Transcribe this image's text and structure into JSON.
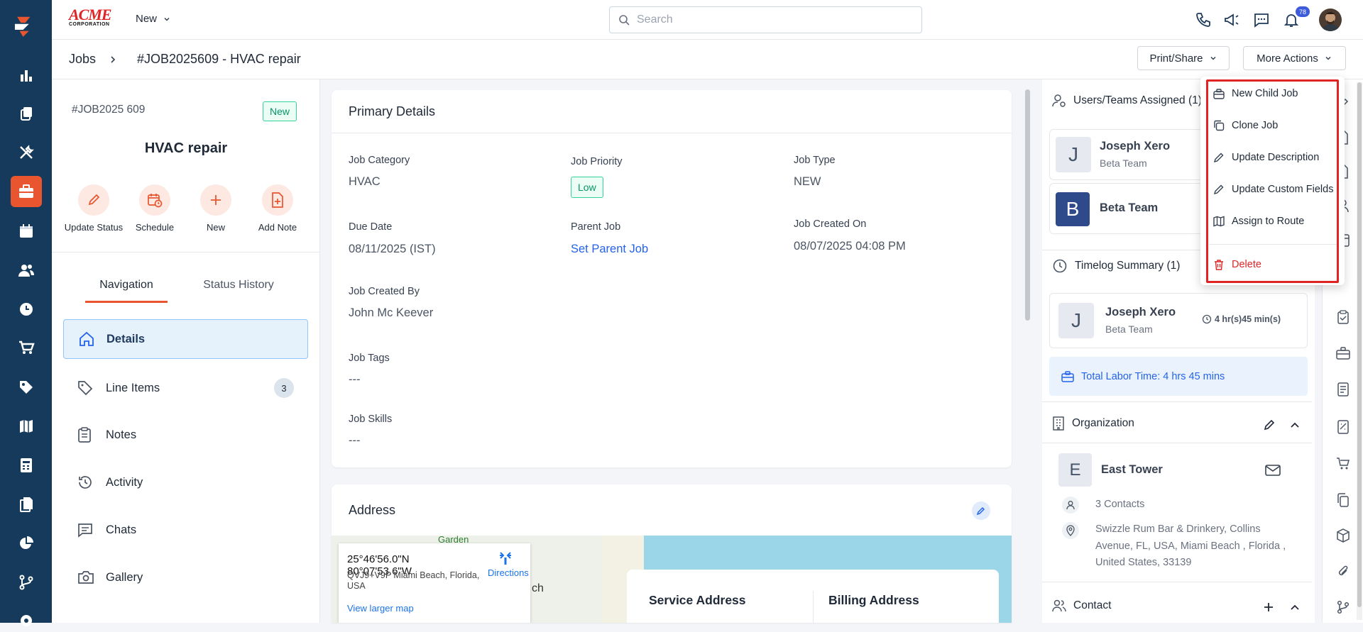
{
  "brand": {
    "logo_text": "ACME",
    "logo_sub": "CORPORATION"
  },
  "topbar": {
    "new_label": "New",
    "search_placeholder": "Search",
    "notification_count": "78"
  },
  "breadcrumb": {
    "root": "Jobs",
    "current": "#JOB2025609 - HVAC repair"
  },
  "header_actions": {
    "print_share": "Print/Share",
    "more_actions": "More Actions"
  },
  "job_summary": {
    "id": "#JOB2025 609",
    "status": "New",
    "title": "HVAC repair",
    "quick_actions": [
      "Update Status",
      "Schedule",
      "New",
      "Add Note"
    ]
  },
  "left_tabs": [
    "Navigation",
    "Status History"
  ],
  "nav_items": [
    {
      "label": "Details",
      "icon": "home-icon"
    },
    {
      "label": "Line Items",
      "icon": "tag-icon",
      "badge": "3"
    },
    {
      "label": "Notes",
      "icon": "clipboard-icon"
    },
    {
      "label": "Activity",
      "icon": "history-icon"
    },
    {
      "label": "Chats",
      "icon": "chat-icon"
    },
    {
      "label": "Gallery",
      "icon": "camera-icon"
    }
  ],
  "primary": {
    "title": "Primary Details",
    "job_category_label": "Job Category",
    "job_category": "HVAC",
    "job_priority_label": "Job Priority",
    "job_priority": "Low",
    "job_type_label": "Job Type",
    "job_type": "NEW",
    "due_date_label": "Due Date",
    "due_date": "08/11/2025 (IST)",
    "parent_job_label": "Parent Job",
    "parent_job": "Set Parent Job",
    "created_on_label": "Job Created On",
    "created_on": "08/07/2025 04:08 PM",
    "created_by_label": "Job Created By",
    "created_by": "John Mc Keever",
    "tags_label": "Job Tags",
    "tags": "---",
    "skills_label": "Job Skills",
    "skills": "---"
  },
  "address": {
    "title": "Address",
    "coords": "25°46'56.0\"N 80°07'53.6\"W",
    "plus_code": "QVJ9+V9P Miami Beach, Florida, USA",
    "directions": "Directions",
    "larger_map": "View larger map",
    "map_text_garden": "Garden",
    "map_text_ch": "ch",
    "service_address": "Service Address",
    "billing_address": "Billing Address"
  },
  "assigned": {
    "title": "Users/Teams Assigned (1)",
    "users": [
      {
        "initial": "J",
        "name": "Joseph Xero",
        "team": "Beta Team"
      }
    ],
    "team": {
      "initial": "B",
      "name": "Beta Team"
    }
  },
  "timelog": {
    "title": "Timelog Summary (1)",
    "initial": "J",
    "name": "Joseph Xero",
    "team": "Beta Team",
    "duration": "4 hr(s)45 min(s)",
    "total": "Total Labor Time: 4 hrs 45 mins"
  },
  "organization": {
    "title": "Organization",
    "initial": "E",
    "name": "East Tower",
    "contacts": "3 Contacts",
    "address": "Swizzle Rum Bar & Drinkery, Collins Avenue, FL, USA, Miami Beach , Florida , United States, 33139"
  },
  "contact": {
    "title": "Contact"
  },
  "more_actions_menu": [
    {
      "label": "New Child Job",
      "icon": "briefcase-icon"
    },
    {
      "label": "Clone Job",
      "icon": "copy-icon"
    },
    {
      "label": "Update Description",
      "icon": "pencil-icon"
    },
    {
      "label": "Update Custom Fields",
      "icon": "pencil-icon"
    },
    {
      "label": "Assign to Route",
      "icon": "map-icon"
    },
    {
      "label": "Delete",
      "icon": "trash-icon"
    }
  ],
  "colors": {
    "sidebar": "#163a5c",
    "accent": "#e8552f",
    "link": "#2563eb",
    "delete": "#dc2626",
    "status_green": "#059669"
  }
}
